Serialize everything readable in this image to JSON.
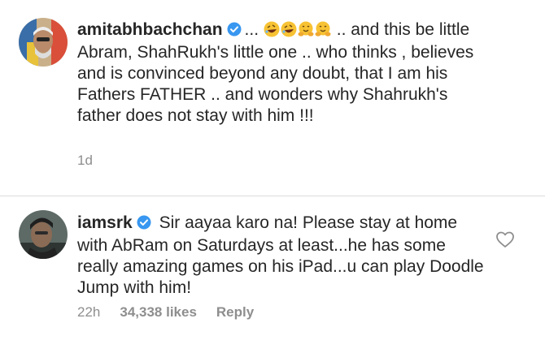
{
  "comments": [
    {
      "username": "amitabhbachchan",
      "verified": true,
      "prefix": "...",
      "emojis": [
        "rofl-emoji",
        "rofl-emoji",
        "hugging-emoji",
        "hugging-emoji"
      ],
      "text_after_emoji": " .. and this be little Abram, ShahRukh's little one .. who thinks , believes and is convinced beyond any doubt, that I am his Fathers FATHER .. and wonders why Shahrukh's father does not stay with him !!!",
      "time": "1d"
    },
    {
      "username": "iamsrk",
      "verified": true,
      "text": "Sir aayaa karo na! Please stay at home with AbRam on Saturdays at least...he has some really amazing games on his iPad...u can play Doodle Jump with him!",
      "time": "22h",
      "likes": "34,338 likes",
      "reply_label": "Reply",
      "like_icon": "heart-outline-icon"
    }
  ],
  "colors": {
    "text": "#262626",
    "meta": "#8e8e8e",
    "verified": "#3897f0",
    "divider": "#dbdbdb"
  }
}
